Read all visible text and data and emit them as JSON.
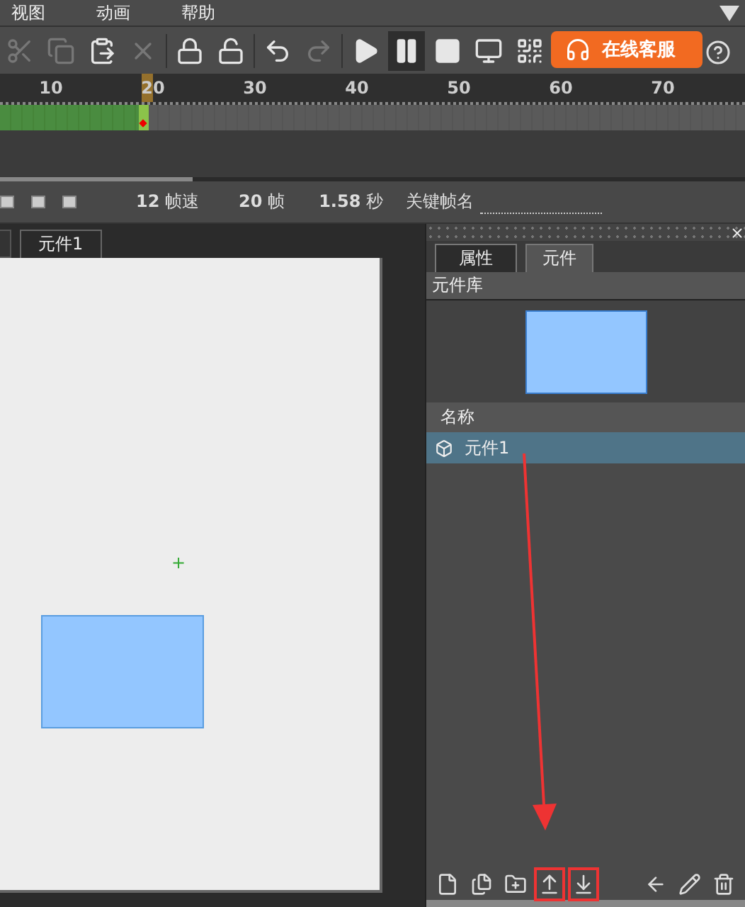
{
  "menu": [
    {
      "label": "视图"
    },
    {
      "label": "动画"
    },
    {
      "label": "帮助"
    }
  ],
  "toolbar": [
    {
      "kind": "cut",
      "disabled": true,
      "selected": false
    },
    {
      "kind": "copy",
      "disabled": true,
      "selected": false
    },
    {
      "kind": "paste",
      "disabled": false,
      "selected": false
    },
    {
      "kind": "delete",
      "disabled": true,
      "selected": false
    },
    {
      "kind": "sep"
    },
    {
      "kind": "lock",
      "disabled": false,
      "selected": false
    },
    {
      "kind": "unlock",
      "disabled": false,
      "selected": false
    },
    {
      "kind": "sep"
    },
    {
      "kind": "undo",
      "disabled": false,
      "selected": false
    },
    {
      "kind": "redo",
      "disabled": true,
      "selected": false
    },
    {
      "kind": "sep"
    },
    {
      "kind": "play",
      "disabled": false,
      "selected": false
    },
    {
      "kind": "pause",
      "disabled": false,
      "selected": true
    },
    {
      "kind": "stop",
      "disabled": false,
      "selected": false
    },
    {
      "kind": "monitor",
      "disabled": false,
      "selected": false
    },
    {
      "kind": "qr",
      "disabled": false,
      "selected": false
    }
  ],
  "service_button": {
    "label": "在线客服"
  },
  "ruler": [
    {
      "label": "10",
      "selected": false
    },
    {
      "label": "20",
      "selected": true
    },
    {
      "label": "30",
      "selected": false
    },
    {
      "label": "40",
      "selected": false
    },
    {
      "label": "50",
      "selected": false
    },
    {
      "label": "60",
      "selected": false
    },
    {
      "label": "70",
      "selected": false
    }
  ],
  "frames": {
    "level": 0.2
  },
  "info": {
    "fps": {
      "value": "12",
      "unit": "帧速"
    },
    "frames": {
      "value": "20",
      "unit": "帧"
    },
    "seconds": {
      "value": "1.58",
      "unit": "秒"
    },
    "keyframe_label": "关键帧名"
  },
  "canvas": {
    "registration_mark": "+"
  },
  "doc_tabs": [
    {
      "label": "元件1",
      "selected": true
    }
  ],
  "panel": {
    "tabs": [
      {
        "label": "属性",
        "selected": false
      },
      {
        "label": "元件",
        "selected": true
      }
    ],
    "library_title": "元件库",
    "column": "名称",
    "items": [
      {
        "name": "元件1",
        "selected": true
      }
    ],
    "tools": [
      {
        "kind": "new",
        "highlighted": false
      },
      {
        "kind": "duplicate",
        "highlighted": false
      },
      {
        "kind": "folder",
        "highlighted": false
      },
      {
        "kind": "import",
        "highlighted": true
      },
      {
        "kind": "export",
        "highlighted": true
      },
      {
        "kind": "spacer"
      },
      {
        "kind": "back",
        "highlighted": false
      },
      {
        "kind": "edit",
        "highlighted": false
      },
      {
        "kind": "delete",
        "highlighted": false
      }
    ]
  }
}
